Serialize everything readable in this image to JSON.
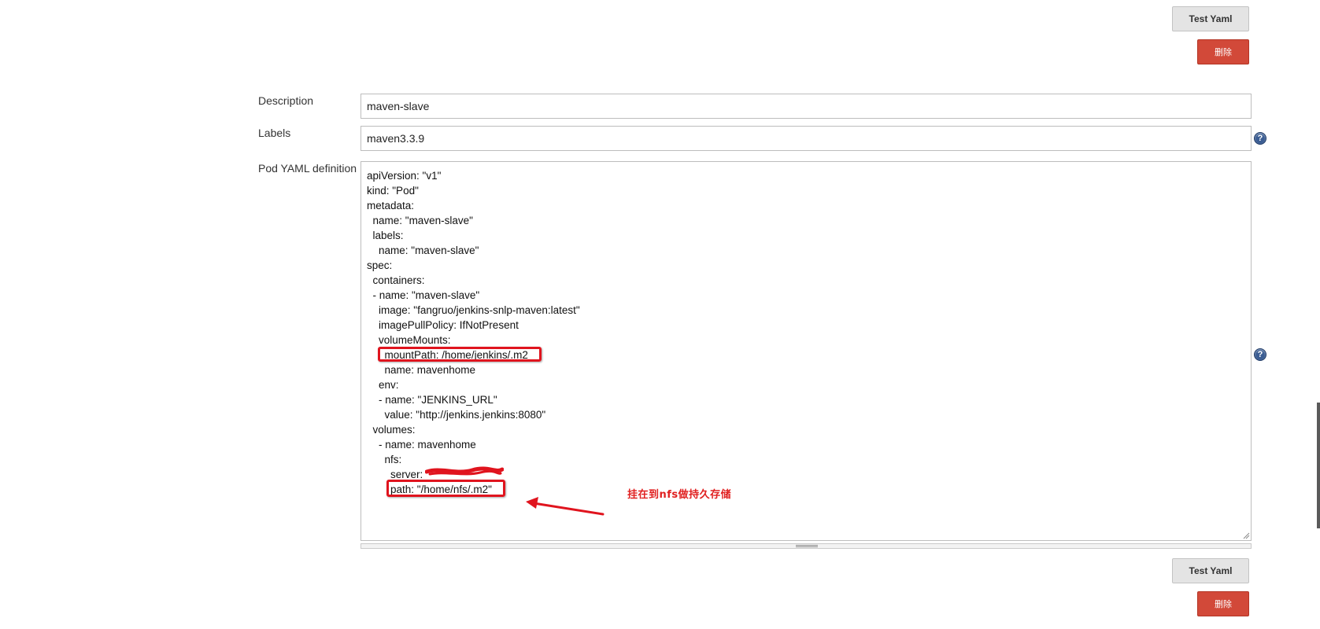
{
  "top_actions": {
    "test_yaml_label": "Test Yaml",
    "delete_label": "删除"
  },
  "form": {
    "description": {
      "label": "Description",
      "value": "maven-slave"
    },
    "labels": {
      "label": "Labels",
      "value": "maven3.3.9"
    },
    "pod_yaml": {
      "label": "Pod YAML definition",
      "lines": [
        "apiVersion: \"v1\"",
        "kind: \"Pod\"",
        "metadata:",
        "  name: \"maven-slave\"",
        "  labels:",
        "    name: \"maven-slave\"",
        "spec:",
        "  containers:",
        "  - name: \"maven-slave\"",
        "    image: \"fangruo/jenkins-snlp-maven:latest\"",
        "    imagePullPolicy: IfNotPresent",
        "    volumeMounts:",
        "      mountPath: /home/jenkins/.m2",
        "      name: mavenhome",
        "    env:",
        "    - name: \"JENKINS_URL\"",
        "      value: \"http://jenkins.jenkins:8080\"",
        "  volumes:",
        "    - name: mavenhome",
        "      nfs:",
        "        server: ",
        "        path: \"/home/nfs/.m2\""
      ]
    }
  },
  "annotation": {
    "note": "挂在到nfs做持久存储",
    "color": "#e0141e"
  },
  "bottom_actions": {
    "test_yaml_label": "Test Yaml",
    "delete_label": "删除"
  },
  "colors": {
    "delete_button": "#d24939",
    "help_icon": "#3b5d93"
  }
}
